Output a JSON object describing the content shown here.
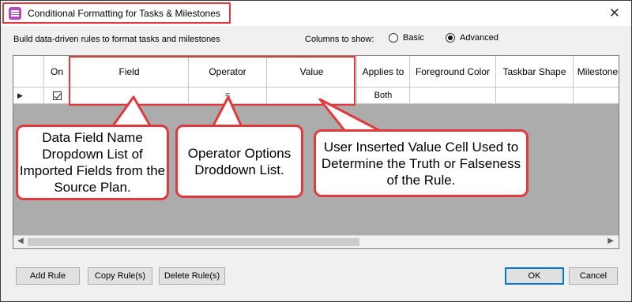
{
  "window": {
    "title": "Conditional Formatting for Tasks & Milestones",
    "close_glyph": "✕"
  },
  "toolbar": {
    "description": "Build data-driven rules to format tasks and milestones",
    "columns_label": "Columns to show:",
    "options": [
      {
        "label": "Basic",
        "selected": false
      },
      {
        "label": "Advanced",
        "selected": true
      }
    ]
  },
  "grid": {
    "columns": [
      "On",
      "Field",
      "Operator",
      "Value",
      "Applies to",
      "Foreground Color",
      "Taskbar Shape",
      "Milestone Shape"
    ],
    "row": {
      "selector_glyph": "▶",
      "on_checked": true,
      "field": "",
      "operator": "=",
      "value": "",
      "applies_to": "Both",
      "foreground_color": "",
      "taskbar_shape": "",
      "milestone_shape": ""
    },
    "scroll_left_glyph": "◀",
    "scroll_right_glyph": "▶"
  },
  "callouts": {
    "field": "Data Field Name Dropdown List of Imported Fields from the Source Plan.",
    "operator": "Operator Options Droddown List.",
    "value": "User Inserted Value Cell Used to Determine the Truth or Falseness of the Rule."
  },
  "buttons": {
    "add_rule": "Add Rule",
    "copy_rules": "Copy Rule(s)",
    "delete_rules": "Delete Rule(s)",
    "ok": "OK",
    "cancel": "Cancel"
  },
  "colors": {
    "annotation_red": "#e0393e",
    "grid_background": "#acacac",
    "app_icon": "#b44fbf"
  }
}
